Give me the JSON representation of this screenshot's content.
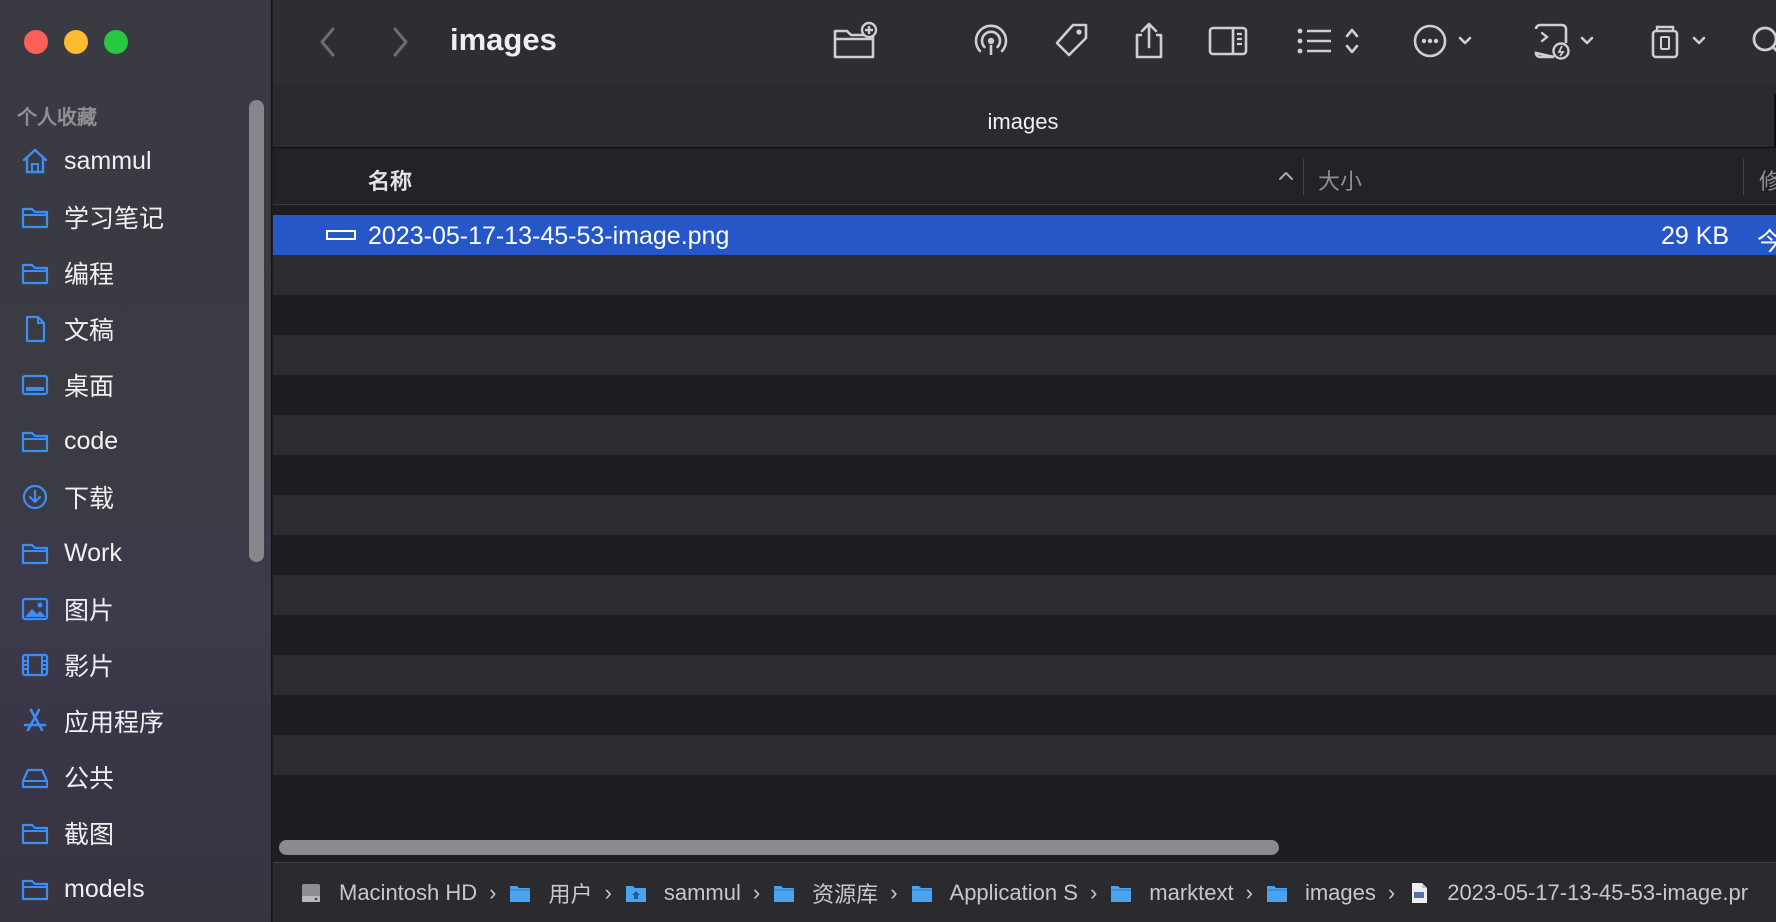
{
  "window": {
    "title": "images"
  },
  "sidebar": {
    "section_title": "个人收藏",
    "items": [
      {
        "label": "sammul",
        "icon": "house-icon"
      },
      {
        "label": "学习笔记",
        "icon": "folder-icon"
      },
      {
        "label": "编程",
        "icon": "folder-icon"
      },
      {
        "label": "文稿",
        "icon": "document-icon"
      },
      {
        "label": "桌面",
        "icon": "desktop-icon"
      },
      {
        "label": "code",
        "icon": "folder-icon"
      },
      {
        "label": "下载",
        "icon": "download-icon"
      },
      {
        "label": "Work",
        "icon": "folder-icon"
      },
      {
        "label": "图片",
        "icon": "photo-icon"
      },
      {
        "label": "影片",
        "icon": "film-icon"
      },
      {
        "label": "应用程序",
        "icon": "apps-icon"
      },
      {
        "label": "公共",
        "icon": "drive-icon"
      },
      {
        "label": "截图",
        "icon": "folder-icon"
      },
      {
        "label": "models",
        "icon": "folder-icon"
      }
    ]
  },
  "tabbar": {
    "title": "images"
  },
  "columns": {
    "name": "名称",
    "size": "大小",
    "modified": "修"
  },
  "files": [
    {
      "name": "2023-05-17-13-45-53-image.png",
      "size": "29 KB",
      "modified": "今",
      "selected": true
    }
  ],
  "pathbar": {
    "items": [
      {
        "label": "Macintosh HD",
        "icon": "disk-icon"
      },
      {
        "label": "用户",
        "icon": "folder-icon"
      },
      {
        "label": "sammul",
        "icon": "home-folder-icon"
      },
      {
        "label": "资源库",
        "icon": "folder-icon"
      },
      {
        "label": "Application S",
        "icon": "folder-icon"
      },
      {
        "label": "marktext",
        "icon": "folder-icon"
      },
      {
        "label": "images",
        "icon": "folder-icon"
      },
      {
        "label": "2023-05-17-13-45-53-image.pr",
        "icon": "image-file-icon"
      }
    ]
  },
  "colors": {
    "accent": "#2f7cf6",
    "selection": "#2557c9",
    "sidebar_icon": "#3b8ef5"
  }
}
